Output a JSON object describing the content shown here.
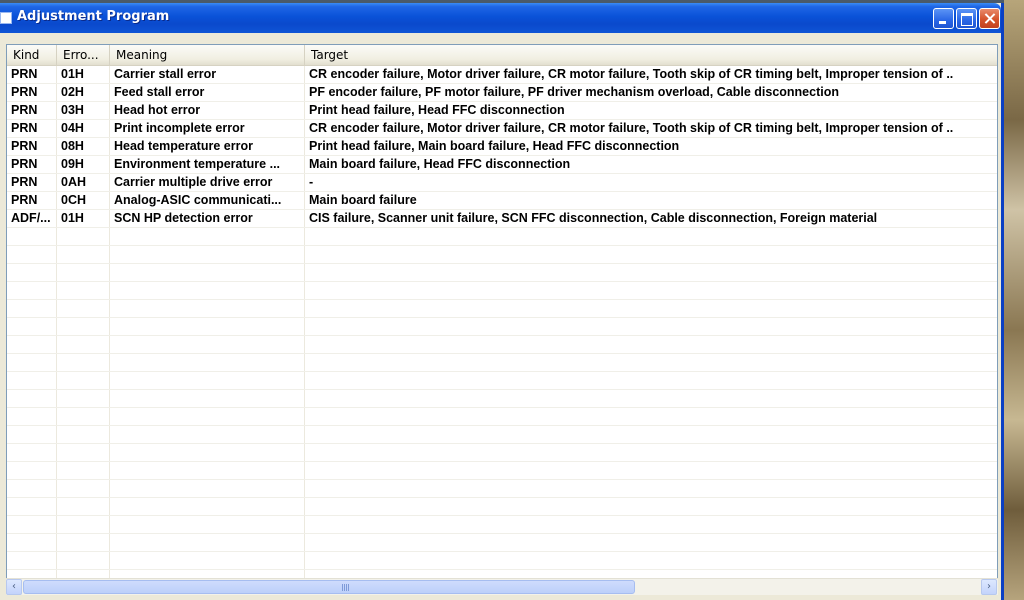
{
  "window": {
    "title": "Adjustment Program"
  },
  "columns": [
    {
      "label": "Kind"
    },
    {
      "label": "Erro..."
    },
    {
      "label": "Meaning"
    },
    {
      "label": "Target"
    }
  ],
  "rows": [
    {
      "kind": "PRN",
      "error": "01H",
      "meaning": "Carrier stall error",
      "target": "CR encoder failure, Motor driver failure, CR motor failure, Tooth skip of CR timing belt, Improper tension of .."
    },
    {
      "kind": "PRN",
      "error": "02H",
      "meaning": "Feed stall error",
      "target": "PF encoder failure, PF motor failure, PF driver mechanism overload, Cable disconnection"
    },
    {
      "kind": "PRN",
      "error": "03H",
      "meaning": "Head hot error",
      "target": "Print head failure, Head FFC disconnection"
    },
    {
      "kind": "PRN",
      "error": "04H",
      "meaning": "Print incomplete error",
      "target": "CR encoder failure, Motor driver failure, CR motor failure, Tooth skip of CR timing belt, Improper tension of .."
    },
    {
      "kind": "PRN",
      "error": "08H",
      "meaning": "Head temperature error",
      "target": "Print head failure, Main board failure, Head FFC disconnection"
    },
    {
      "kind": "PRN",
      "error": "09H",
      "meaning": "Environment temperature ...",
      "target": "Main board failure, Head FFC disconnection"
    },
    {
      "kind": "PRN",
      "error": "0AH",
      "meaning": "Carrier multiple drive error",
      "target": "-"
    },
    {
      "kind": "PRN",
      "error": "0CH",
      "meaning": "Analog-ASIC communicati...",
      "target": "Main board failure"
    },
    {
      "kind": "ADF/...",
      "error": "01H",
      "meaning": "SCN HP detection error",
      "target": "CIS failure, Scanner unit failure, SCN FFC disconnection, Cable disconnection, Foreign material"
    }
  ],
  "scrollbar": {
    "left_arrow": "‹",
    "right_arrow": "›"
  }
}
